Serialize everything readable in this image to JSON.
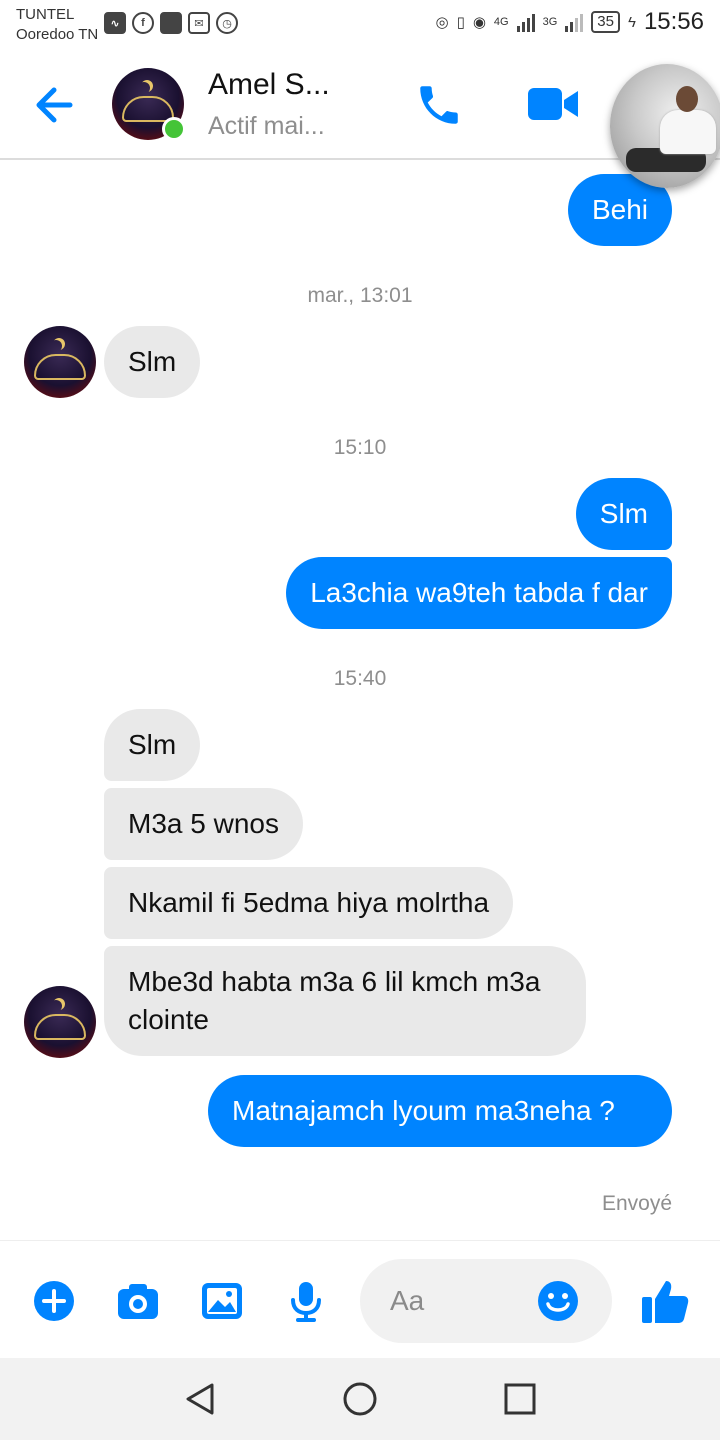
{
  "status_bar": {
    "carrier_top": "TUNTEL",
    "carrier_bottom": "Ooredoo TN",
    "network_4g": "4G",
    "network_3g": "3G",
    "battery": "35",
    "time": "15:56"
  },
  "header": {
    "contact_name": "Amel S...",
    "contact_status": "Actif mai...",
    "icons": [
      "back-arrow-icon",
      "phone-icon",
      "video-camera-icon"
    ],
    "accent_color": "#0084ff"
  },
  "messages": [
    {
      "id": "m1",
      "direction": "outgoing",
      "text": "Behi"
    },
    {
      "id": "t1",
      "type": "timestamp",
      "text": "mar., 13:01"
    },
    {
      "id": "m2",
      "direction": "incoming",
      "text": "Slm"
    },
    {
      "id": "t2",
      "type": "timestamp",
      "text": "15:10"
    },
    {
      "id": "m3",
      "direction": "outgoing",
      "text": "Slm"
    },
    {
      "id": "m4",
      "direction": "outgoing",
      "text": "La3chia wa9teh tabda f dar"
    },
    {
      "id": "t3",
      "type": "timestamp",
      "text": "15:40"
    },
    {
      "id": "m5",
      "direction": "incoming",
      "text": "Slm"
    },
    {
      "id": "m6",
      "direction": "incoming",
      "text": "M3a 5 wnos"
    },
    {
      "id": "m7",
      "direction": "incoming",
      "text": "Nkamil fi 5edma hiya molrtha"
    },
    {
      "id": "m8",
      "direction": "incoming",
      "text": "Mbe3d habta m3a 6 lil kmch m3a clointe"
    },
    {
      "id": "m9",
      "direction": "outgoing",
      "text": "Matnajamch lyoum ma3neha ?"
    }
  ],
  "sent_status": "Envoyé",
  "composer": {
    "placeholder": "Aa",
    "icons": [
      "plus-icon",
      "camera-icon",
      "image-icon",
      "microphone-icon",
      "emoji-icon",
      "thumbs-up-icon"
    ]
  },
  "nav": {
    "icons": [
      "back-triangle-icon",
      "home-circle-icon",
      "recents-square-icon"
    ]
  },
  "colors": {
    "outgoing_bubble": "#0084ff",
    "incoming_bubble": "#e9e9e9",
    "online_dot": "#44c437"
  }
}
